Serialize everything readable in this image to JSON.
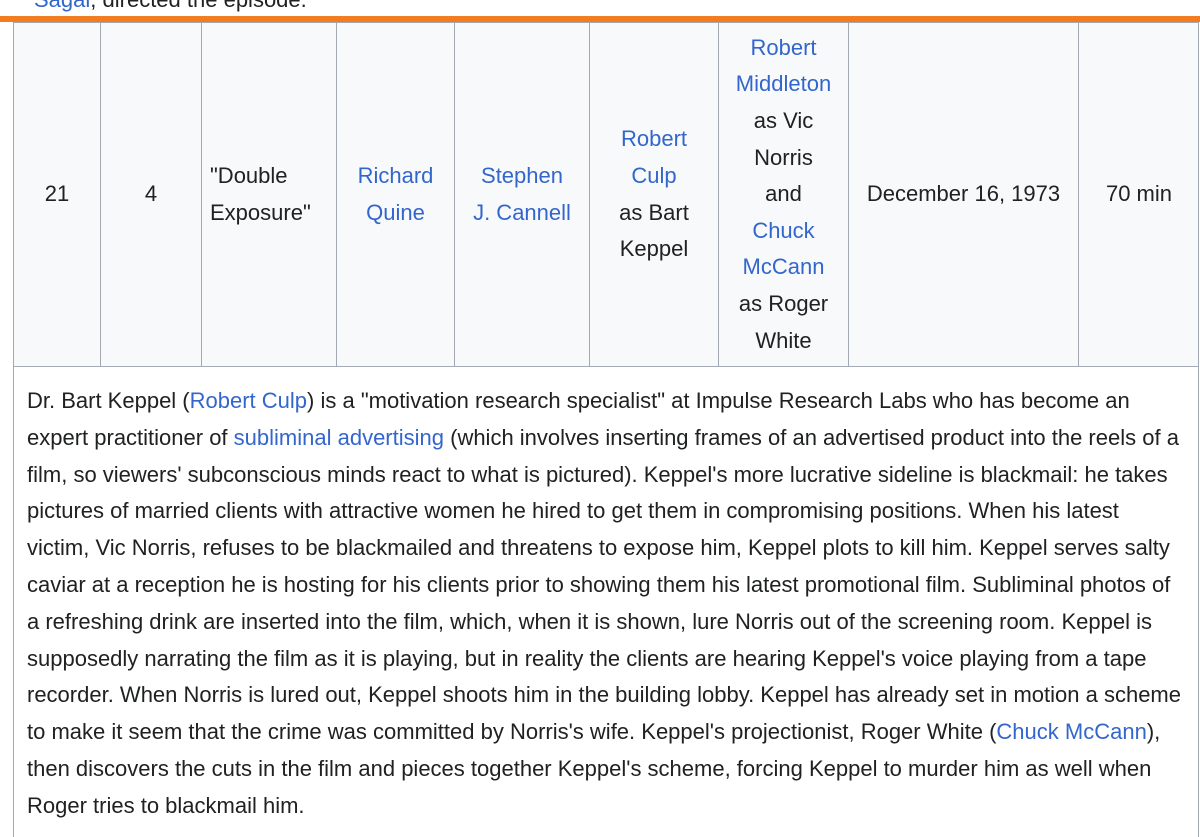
{
  "previous": {
    "link": "Sagal",
    "text": ", directed the episode."
  },
  "episode": {
    "no_overall": "21",
    "no_in_season": "4",
    "title": "\"Double Exposure\"",
    "director": [
      "Richard",
      "Quine"
    ],
    "writer": [
      "Stephen",
      "J. Cannell"
    ],
    "murderer": {
      "name": [
        "Robert",
        "Culp"
      ],
      "as": [
        "as Bart",
        "Keppel"
      ]
    },
    "victims": {
      "v1_name": [
        "Robert",
        "Middleton"
      ],
      "v1_as": [
        "as Vic",
        "Norris"
      ],
      "and": "and",
      "v2_name": [
        "Chuck",
        "McCann"
      ],
      "v2_as": [
        "as Roger",
        "White"
      ]
    },
    "air_date": "December 16, 1973",
    "runtime": "70 min"
  },
  "summary": {
    "s1": "Dr. Bart Keppel (",
    "l1": "Robert Culp",
    "s2": ") is a \"motivation research specialist\" at Impulse Research Labs who has become an expert practitioner of ",
    "l2": "subliminal advertising",
    "s3": " (which involves inserting frames of an advertised product into the reels of a film, so viewers' subconscious minds react to what is pictured). Keppel's more lucrative sideline is blackmail: he takes pictures of married clients with attractive women he hired to get them in compromising positions. When his latest victim, Vic Norris, refuses to be blackmailed and threatens to expose him, Keppel plots to kill him. Keppel serves salty caviar at a reception he is hosting for his clients prior to showing them his latest promotional film. Subliminal photos of a refreshing drink are inserted into the film, which, when it is shown, lure Norris out of the screening room. Keppel is supposedly narrating the film as it is playing, but in reality the clients are hearing Keppel's voice playing from a tape recorder. When Norris is lured out, Keppel shoots him in the building lobby. Keppel has already set in motion a scheme to make it seem that the crime was committed by Norris's wife. Keppel's projectionist, Roger White (",
    "l3": "Chuck McCann",
    "s4": "), then discovers the cuts in the film and pieces together Keppel's scheme, forcing Keppel to murder him as well when Roger tries to blackmail him."
  },
  "colors": {
    "link": "#3366cc",
    "text": "#202122",
    "border": "#a2a9b1",
    "row_bg": "#f8f9fa",
    "divider": "#f47c20"
  }
}
